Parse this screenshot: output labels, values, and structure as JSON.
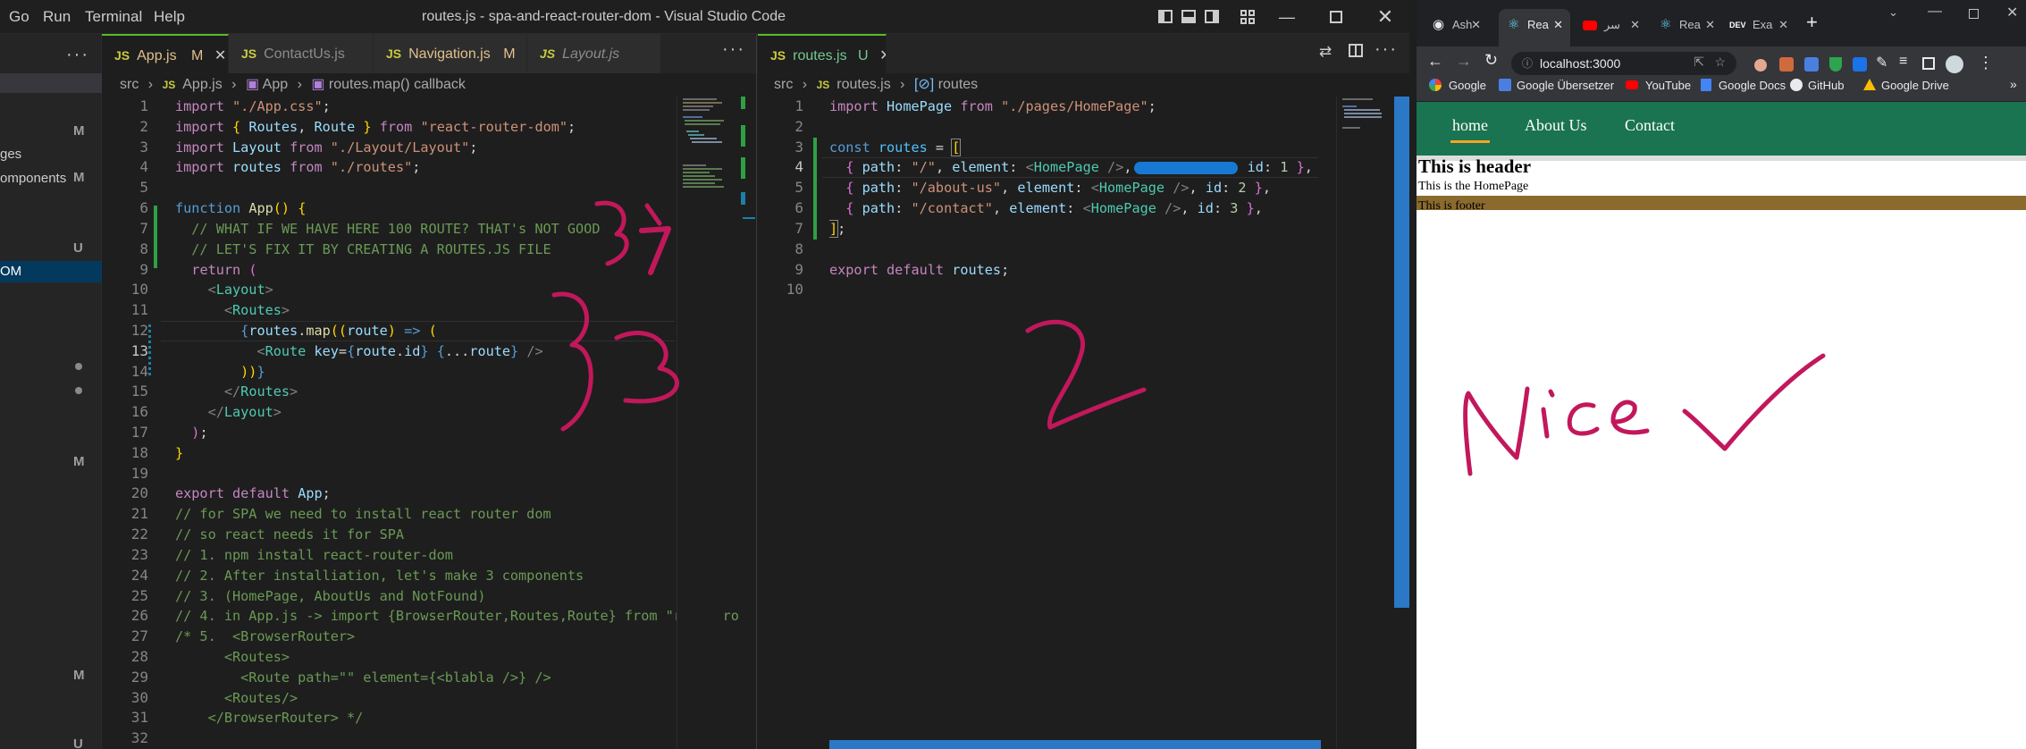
{
  "vscode": {
    "menu": [
      "Go",
      "Run",
      "Terminal",
      "Help"
    ],
    "window_title": "routes.js - spa-and-react-router-dom - Visual Studio Code",
    "sidebar": {
      "items": [
        {
          "label": "ges",
          "badge": "M"
        },
        {
          "label": "omponents",
          "badge": "M"
        },
        {
          "label": "",
          "badge": "U"
        },
        {
          "label": "OM",
          "badge": ""
        },
        {
          "label": "",
          "badge": "M"
        },
        {
          "label": "",
          "badge": "M"
        },
        {
          "label": "",
          "badge": "U"
        }
      ],
      "first_badge": "M"
    },
    "left_tabs": [
      {
        "name": "App.js",
        "status": "M"
      },
      {
        "name": "ContactUs.js",
        "status": ""
      },
      {
        "name": "Navigation.js",
        "status": "M"
      },
      {
        "name": "Layout.js",
        "status": ""
      }
    ],
    "right_tabs": [
      {
        "name": "routes.js",
        "status": "U"
      }
    ],
    "file_icon": "JS",
    "left_breadcrumb": [
      "src",
      "App.js",
      "App",
      "routes.map() callback"
    ],
    "right_breadcrumb": [
      "src",
      "routes.js",
      "routes"
    ],
    "left_code_lines": 32,
    "right_code_lines": 10,
    "left_code": [
      "import \"./App.css\";",
      "import { Routes, Route } from \"react-router-dom\";",
      "import Layout from \"./Layout/Layout\";",
      "import routes from \"./routes\";",
      "",
      "function App() {",
      "  // WHAT IF WE HAVE HERE 100 ROUTE? THAT's NOT GOOD",
      "  // LET'S FIX IT BY CREATING A ROUTES.JS FILE",
      "  return (",
      "    <Layout>",
      "      <Routes>",
      "        {routes.map((route) => (",
      "          <Route key={route.id} {...route} />",
      "        ))}",
      "      </Routes>",
      "    </Layout>",
      "  );",
      "}",
      "",
      "export default App;",
      "// for SPA we need to install react router dom",
      "// so react needs it for SPA",
      "// 1. npm install react-router-dom",
      "// 2. After installiation, let's make 3 components",
      "// 3. (HomePage, AboutUs and NotFound)",
      "// 4. in App.js -> import {BrowserRouter,Routes,Route} from \"react-ro",
      "/* 5.  <BrowserRouter>",
      "      <Routes>",
      "        <Route path=\"\" element={<blabla />} />",
      "      <Routes/>",
      "    </BrowserRouter> */",
      ""
    ],
    "right_code": [
      "import HomePage from \"./pages/HomePage\";",
      "",
      "const routes = [",
      "  { path: \"/\", element: <HomePage />, ████████ id: 1 },",
      "  { path: \"/about-us\", element: <HomePage />, id: 2 },",
      "  { path: \"/contact\", element: <HomePage />, id: 3 },",
      "];",
      "",
      "export default routes;",
      ""
    ],
    "annotations": [
      "1",
      "3",
      "2"
    ]
  },
  "browser": {
    "tabs": [
      {
        "label": "Ash",
        "icon": "github-icon"
      },
      {
        "label": "Rea",
        "icon": "react-icon",
        "active": true
      },
      {
        "label": "سر",
        "icon": "youtube-icon"
      },
      {
        "label": "Rea",
        "icon": "react-icon"
      },
      {
        "label": "Exa",
        "icon": "dev-icon"
      }
    ],
    "new_tab": "+",
    "url": "localhost:3000",
    "bookmarks": [
      "Google",
      "Google Übersetzer",
      "YouTube",
      "Google Docs",
      "GitHub",
      "Google Drive"
    ],
    "nav_links": [
      "home",
      "About Us",
      "Contact"
    ],
    "header_text": "This is header",
    "home_text": "This is the HomePage",
    "footer_text": "This is footer",
    "handwriting": "Nice ✓",
    "colors": {
      "nav_bg": "#1a7351",
      "footer_bg": "#8b6a2e",
      "ink": "#c2185b",
      "nav_active_underline": "#f5a623"
    }
  }
}
